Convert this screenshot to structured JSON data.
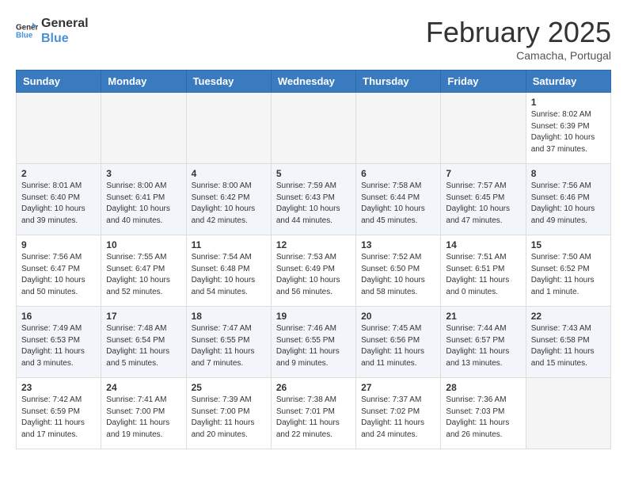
{
  "header": {
    "logo_line1": "General",
    "logo_line2": "Blue",
    "month_title": "February 2025",
    "location": "Camacha, Portugal"
  },
  "weekdays": [
    "Sunday",
    "Monday",
    "Tuesday",
    "Wednesday",
    "Thursday",
    "Friday",
    "Saturday"
  ],
  "weeks": [
    [
      {
        "day": "",
        "info": ""
      },
      {
        "day": "",
        "info": ""
      },
      {
        "day": "",
        "info": ""
      },
      {
        "day": "",
        "info": ""
      },
      {
        "day": "",
        "info": ""
      },
      {
        "day": "",
        "info": ""
      },
      {
        "day": "1",
        "info": "Sunrise: 8:02 AM\nSunset: 6:39 PM\nDaylight: 10 hours\nand 37 minutes."
      }
    ],
    [
      {
        "day": "2",
        "info": "Sunrise: 8:01 AM\nSunset: 6:40 PM\nDaylight: 10 hours\nand 39 minutes."
      },
      {
        "day": "3",
        "info": "Sunrise: 8:00 AM\nSunset: 6:41 PM\nDaylight: 10 hours\nand 40 minutes."
      },
      {
        "day": "4",
        "info": "Sunrise: 8:00 AM\nSunset: 6:42 PM\nDaylight: 10 hours\nand 42 minutes."
      },
      {
        "day": "5",
        "info": "Sunrise: 7:59 AM\nSunset: 6:43 PM\nDaylight: 10 hours\nand 44 minutes."
      },
      {
        "day": "6",
        "info": "Sunrise: 7:58 AM\nSunset: 6:44 PM\nDaylight: 10 hours\nand 45 minutes."
      },
      {
        "day": "7",
        "info": "Sunrise: 7:57 AM\nSunset: 6:45 PM\nDaylight: 10 hours\nand 47 minutes."
      },
      {
        "day": "8",
        "info": "Sunrise: 7:56 AM\nSunset: 6:46 PM\nDaylight: 10 hours\nand 49 minutes."
      }
    ],
    [
      {
        "day": "9",
        "info": "Sunrise: 7:56 AM\nSunset: 6:47 PM\nDaylight: 10 hours\nand 50 minutes."
      },
      {
        "day": "10",
        "info": "Sunrise: 7:55 AM\nSunset: 6:47 PM\nDaylight: 10 hours\nand 52 minutes."
      },
      {
        "day": "11",
        "info": "Sunrise: 7:54 AM\nSunset: 6:48 PM\nDaylight: 10 hours\nand 54 minutes."
      },
      {
        "day": "12",
        "info": "Sunrise: 7:53 AM\nSunset: 6:49 PM\nDaylight: 10 hours\nand 56 minutes."
      },
      {
        "day": "13",
        "info": "Sunrise: 7:52 AM\nSunset: 6:50 PM\nDaylight: 10 hours\nand 58 minutes."
      },
      {
        "day": "14",
        "info": "Sunrise: 7:51 AM\nSunset: 6:51 PM\nDaylight: 11 hours\nand 0 minutes."
      },
      {
        "day": "15",
        "info": "Sunrise: 7:50 AM\nSunset: 6:52 PM\nDaylight: 11 hours\nand 1 minute."
      }
    ],
    [
      {
        "day": "16",
        "info": "Sunrise: 7:49 AM\nSunset: 6:53 PM\nDaylight: 11 hours\nand 3 minutes."
      },
      {
        "day": "17",
        "info": "Sunrise: 7:48 AM\nSunset: 6:54 PM\nDaylight: 11 hours\nand 5 minutes."
      },
      {
        "day": "18",
        "info": "Sunrise: 7:47 AM\nSunset: 6:55 PM\nDaylight: 11 hours\nand 7 minutes."
      },
      {
        "day": "19",
        "info": "Sunrise: 7:46 AM\nSunset: 6:55 PM\nDaylight: 11 hours\nand 9 minutes."
      },
      {
        "day": "20",
        "info": "Sunrise: 7:45 AM\nSunset: 6:56 PM\nDaylight: 11 hours\nand 11 minutes."
      },
      {
        "day": "21",
        "info": "Sunrise: 7:44 AM\nSunset: 6:57 PM\nDaylight: 11 hours\nand 13 minutes."
      },
      {
        "day": "22",
        "info": "Sunrise: 7:43 AM\nSunset: 6:58 PM\nDaylight: 11 hours\nand 15 minutes."
      }
    ],
    [
      {
        "day": "23",
        "info": "Sunrise: 7:42 AM\nSunset: 6:59 PM\nDaylight: 11 hours\nand 17 minutes."
      },
      {
        "day": "24",
        "info": "Sunrise: 7:41 AM\nSunset: 7:00 PM\nDaylight: 11 hours\nand 19 minutes."
      },
      {
        "day": "25",
        "info": "Sunrise: 7:39 AM\nSunset: 7:00 PM\nDaylight: 11 hours\nand 20 minutes."
      },
      {
        "day": "26",
        "info": "Sunrise: 7:38 AM\nSunset: 7:01 PM\nDaylight: 11 hours\nand 22 minutes."
      },
      {
        "day": "27",
        "info": "Sunrise: 7:37 AM\nSunset: 7:02 PM\nDaylight: 11 hours\nand 24 minutes."
      },
      {
        "day": "28",
        "info": "Sunrise: 7:36 AM\nSunset: 7:03 PM\nDaylight: 11 hours\nand 26 minutes."
      },
      {
        "day": "",
        "info": ""
      }
    ]
  ]
}
